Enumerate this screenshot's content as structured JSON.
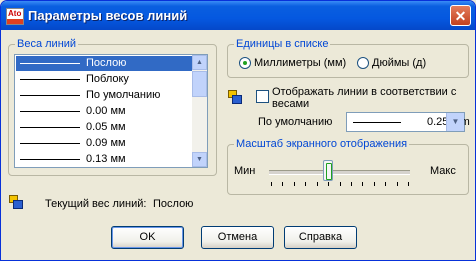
{
  "window": {
    "title": "Параметры весов линий",
    "app_icon_text": "Ato"
  },
  "lineweights": {
    "group_label": "Веса линий",
    "items": [
      "Послою",
      "Поблоку",
      "По умолчанию",
      "0.00 мм",
      "0.05 мм",
      "0.09 мм",
      "0.13 мм"
    ],
    "selected": "Послою"
  },
  "units": {
    "group_label": "Единицы в списке",
    "options": [
      "Миллиметры (мм)",
      "Дюймы (д)"
    ],
    "selected": "Миллиметры (мм)"
  },
  "display": {
    "checkbox_label": "Отображать линии в соответствии с весами",
    "checked": false
  },
  "default_weight": {
    "label": "По умолчанию",
    "value": "0.25 mm"
  },
  "scale": {
    "group_label": "Масштаб экранного отображения",
    "min_label": "Мин",
    "max_label": "Макс",
    "level": 0.42
  },
  "current": {
    "label": "Текущий вес линий:",
    "value": "Послою"
  },
  "buttons": {
    "ok": "OK",
    "cancel": "Отмена",
    "help": "Справка"
  },
  "colors": {
    "title_bar": "#0558e0",
    "selection": "#316ac5",
    "group_label": "#0046d5",
    "close_button": "#c2411f"
  }
}
